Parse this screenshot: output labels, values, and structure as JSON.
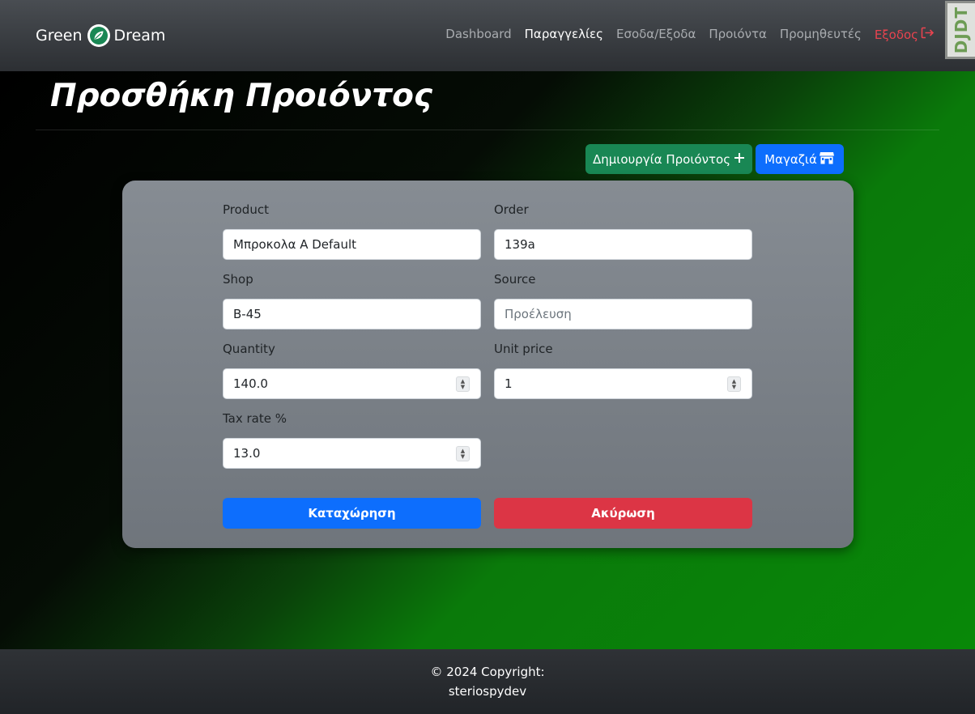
{
  "navbar": {
    "brand_left": "Green",
    "brand_right": "Dream",
    "links": [
      {
        "label": "Dashboard"
      },
      {
        "label": "Παραγγελίες"
      },
      {
        "label": "Εσοδα/Εξοδα"
      },
      {
        "label": "Προιόντα"
      },
      {
        "label": "Προμηθευτές"
      },
      {
        "label": "Εξοδος"
      }
    ],
    "active_link": "Παραγγελίες",
    "debug_toolbar": "DJDT"
  },
  "page": {
    "title": "Προσθήκη Προιόντος"
  },
  "actions": {
    "create_product": "Δημιουργία Προιόντος",
    "shop": "Μαγαζιά"
  },
  "form": {
    "product": {
      "label": "Product",
      "value": "Μπροκολα A Default"
    },
    "order": {
      "label": "Order",
      "value": "139a"
    },
    "shop": {
      "label": "Shop",
      "value": "B-45"
    },
    "source": {
      "label": "Source",
      "value": "",
      "placeholder": "Προέλευση"
    },
    "quantity": {
      "label": "Quantity",
      "value": "140.0"
    },
    "unit_price": {
      "label": "Unit price",
      "value": "1"
    },
    "tax_rate": {
      "label": "Tax rate %",
      "value": "13.0"
    },
    "submit": "Καταχώρηση",
    "cancel": "Ακύρωση"
  },
  "footer": {
    "copyright": "© 2024 Copyright:",
    "author": "steriospydev"
  },
  "colors": {
    "primary": "#0d6efd",
    "success": "#198754",
    "danger": "#dc3545",
    "logout": "#e8434f"
  },
  "icons": {
    "brand": "leaf-icon",
    "logout": "sign-out-icon",
    "create": "plus-icon",
    "shop": "store-icon"
  }
}
